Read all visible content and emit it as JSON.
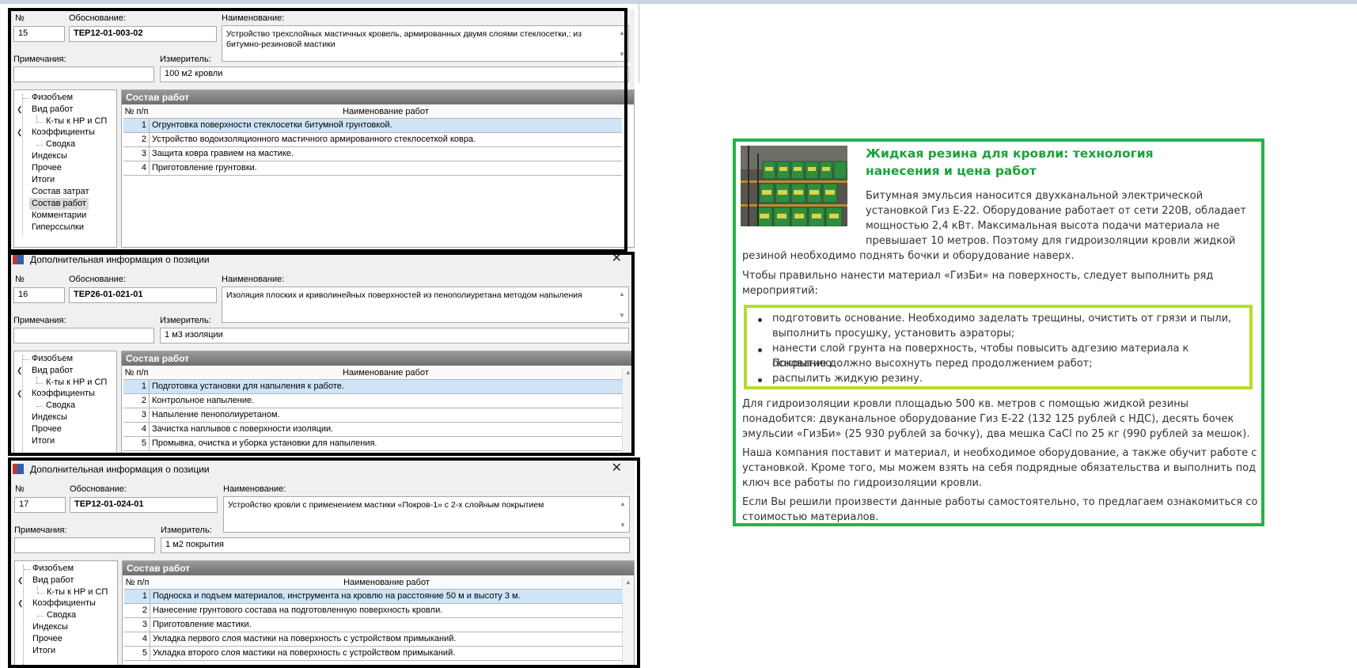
{
  "common": {
    "label_num": "№",
    "label_basis": "Обоснование:",
    "label_name": "Наименование:",
    "label_notes": "Примечания:",
    "label_unit": "Измеритель:",
    "section_title": "Состав работ",
    "col_num": "№ п/п",
    "col_name": "Наименование работ",
    "dialog_title": "Дополнительная информация о позиции",
    "tree": {
      "fizobem": "Физобъем",
      "vid_rabot": "Вид работ",
      "kty": "К-ты к НР и СП",
      "koef": "Коэффициенты",
      "svodka": "Сводка",
      "indeksy": "Индексы",
      "prochee": "Прочее",
      "itogi": "Итоги",
      "sostav_zatrat": "Состав затрат",
      "sostav_rabot": "Состав работ",
      "kommentarii": "Комментарии",
      "giperssylki": "Гиперссылки"
    }
  },
  "panel1": {
    "num": "15",
    "basis": "ТЕР12-01-003-02",
    "name": "Устройство трехслойных мастичных кровель, армированных двумя слоями стеклосетки,: из битумно-резиновой мастики",
    "notes": "",
    "unit": "100 м2 кровли",
    "rows": [
      {
        "n": "1",
        "text": "Огрунтовка поверхности стеклосетки битумной грунтовкой."
      },
      {
        "n": "2",
        "text": "Устройство водоизоляционного мастичного армированного стеклосеткой ковра."
      },
      {
        "n": "3",
        "text": "Защита ковра гравием на мастике."
      },
      {
        "n": "4",
        "text": "Приготовление грунтовки."
      }
    ]
  },
  "panel2": {
    "num": "16",
    "basis": "ТЕР26-01-021-01",
    "name": "Изоляция плоских и криволинейных поверхностей из пенополиуретана методом напыления",
    "notes": "",
    "unit": "1 м3 изоляции",
    "rows": [
      {
        "n": "1",
        "text": "Подготовка установки для напыления к работе."
      },
      {
        "n": "2",
        "text": "Контрольное напыление."
      },
      {
        "n": "3",
        "text": "Напыление пенополиуретаном."
      },
      {
        "n": "4",
        "text": "Зачистка наплывов с поверхности изоляции."
      },
      {
        "n": "5",
        "text": "Промывка, очистка и уборка установки для напыления."
      }
    ]
  },
  "panel3": {
    "num": "17",
    "basis": "ТЕР12-01-024-01",
    "name": "Устройство кровли с применением мастики «Покров-1» с 2-х слойным покрытием",
    "notes": "",
    "unit": "1 м2 покрытия",
    "rows": [
      {
        "n": "1",
        "text": "Подноска и подъем материалов, инструмента на кровлю на расстояние 50 м и высоту 3 м."
      },
      {
        "n": "2",
        "text": "Нанесение грунтового состава на подготовленную поверхность кровли."
      },
      {
        "n": "3",
        "text": "Приготовление мастики."
      },
      {
        "n": "4",
        "text": "Укладка первого слоя мастики на поверхность с устройством примыканий."
      },
      {
        "n": "5",
        "text": "Укладка второго слоя мастики на поверхность с устройством примыканий."
      }
    ]
  },
  "article": {
    "title": "Жидкая резина для кровли: технология нанесения и цена работ",
    "p1_lines": [
      "Битумная эмульсия наносится двухканальной электрической",
      "установкой Гиз Е-22. Оборудование работает от сети 220В, обладает",
      "мощностью 2,4 кВт. Максимальная высота подачи материала не",
      "превышает 10 метров. Поэтому для гидроизоляции кровли жидкой"
    ],
    "p1_last": "резиной необходимо поднять бочки и оборудование наверх.",
    "p2_lines": [
      "Чтобы правильно нанести материал «ГизБи» на поверхность, следует выполнить ряд",
      "мероприятий:"
    ],
    "bullets": [
      [
        "подготовить основание. Необходимо заделать трещины, очистить от грязи и пыли,",
        "выполнить просушку, установить аэраторы;"
      ],
      [
        "нанести слой грунта на поверхность, чтобы повысить адгезию материала к основанию.",
        "Покрытие должно высохнуть перед продолжением работ;"
      ],
      [
        "распылить жидкую резину."
      ]
    ],
    "p3_lines": [
      "Для гидроизоляции кровли площадью 500 кв. метров с помощью жидкой резины",
      "понадобится: двуканальное оборудование Гиз Е-22 (132 125 рублей с НДС), десять бочек",
      "эмульсии «ГизБи» (25 930 рублей за бочку), два мешка CaCl по 25 кг (990 рублей за мешок)."
    ],
    "p4_lines": [
      "Наша компания поставит и материал, и необходимое оборудование, а также обучит работе с",
      "установкой. Кроме того, мы можем взять на себя подрядные обязательства и выполнить под",
      "ключ все работы по гидроизоляции кровли."
    ],
    "p5_lines": [
      "Если Вы решили произвести данные работы самостоятельно, то предлагаем ознакомиться со",
      "стоимостью материалов."
    ]
  },
  "colors": {
    "article_border": "#26b24b",
    "title_green": "#1aa33a",
    "bullet_border": "#b6de24",
    "row_selected": "#cfe5f7"
  }
}
